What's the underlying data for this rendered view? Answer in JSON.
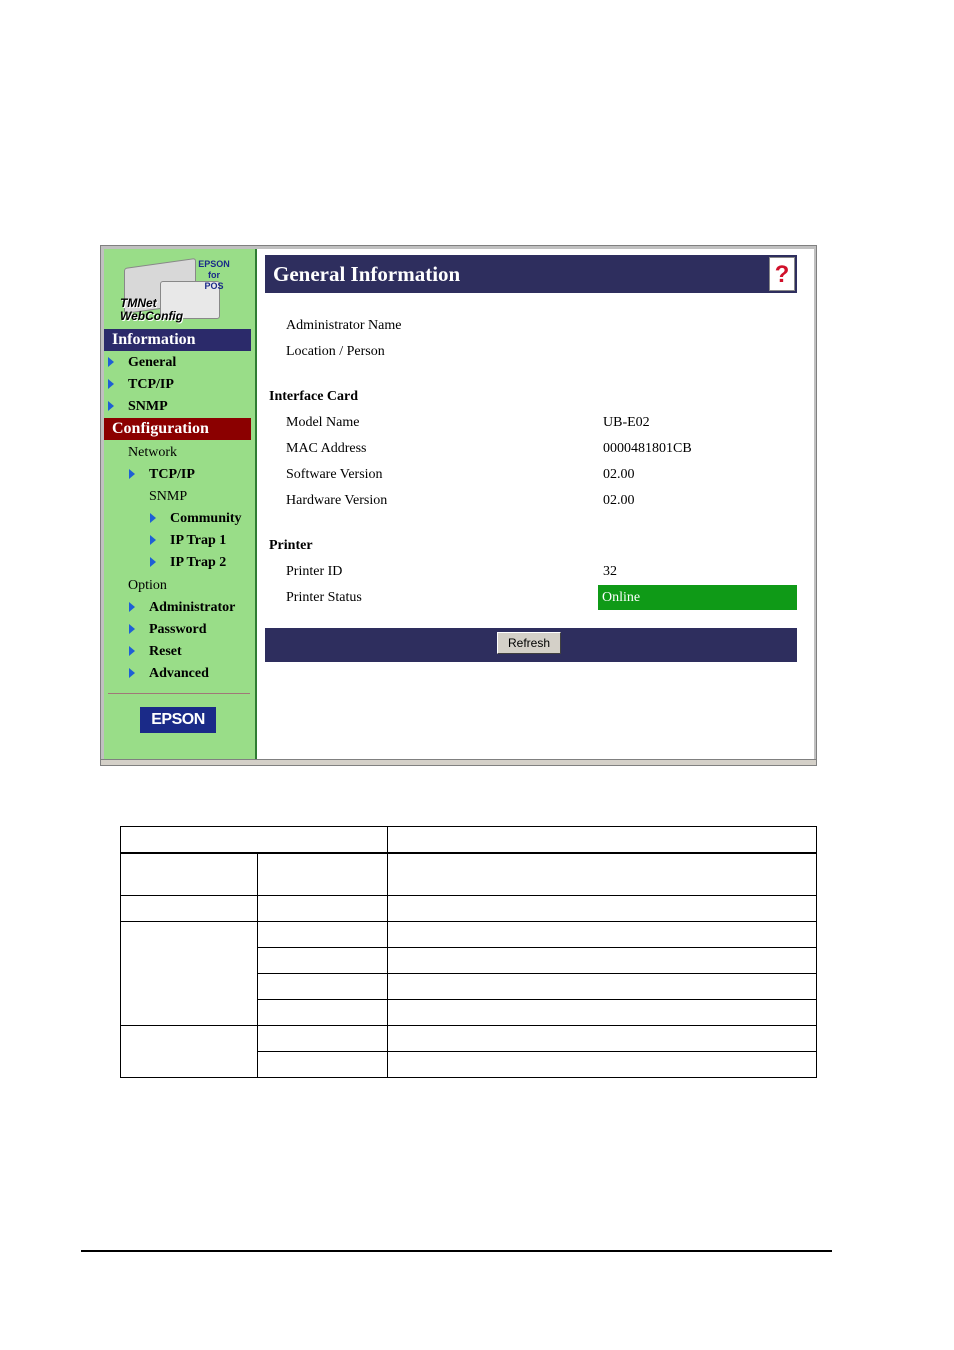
{
  "sidebar": {
    "logo": {
      "brand_tag": [
        "EPSON",
        "for",
        "POS"
      ],
      "product_name_line1": "TMNet",
      "product_name_line2": "WebConfig"
    },
    "information": {
      "header": "Information",
      "items": [
        {
          "label": "General"
        },
        {
          "label": "TCP/IP"
        },
        {
          "label": "SNMP"
        }
      ]
    },
    "configuration": {
      "header": "Configuration",
      "network_label": "Network",
      "tcpip": "TCP/IP",
      "snmp_label": "SNMP",
      "snmp_items": [
        {
          "label": "Community"
        },
        {
          "label": "IP Trap 1"
        },
        {
          "label": "IP Trap 2"
        }
      ],
      "option_label": "Option",
      "option_items": [
        {
          "label": "Administrator"
        },
        {
          "label": "Password"
        },
        {
          "label": "Reset"
        },
        {
          "label": "Advanced"
        }
      ]
    },
    "footer_logo": "EPSON"
  },
  "content": {
    "title": "General Information",
    "help_icon": "?",
    "admin": {
      "name_label": "Administrator Name",
      "location_label": "Location / Person"
    },
    "interface_card": {
      "heading": "Interface Card",
      "rows": [
        {
          "label": "Model Name",
          "value": "UB-E02"
        },
        {
          "label": "MAC Address",
          "value": "0000481801CB"
        },
        {
          "label": "Software Version",
          "value": "02.00"
        },
        {
          "label": "Hardware Version",
          "value": "02.00"
        }
      ]
    },
    "printer": {
      "heading": "Printer",
      "printer_id_label": "Printer ID",
      "printer_id_value": "32",
      "status_label": "Printer Status",
      "status_value": "Online"
    },
    "refresh_button": "Refresh"
  },
  "colors": {
    "title_bar": "#2e2e5e",
    "sidebar_bg": "#99dd88",
    "info_header": "#2b2a6a",
    "config_header": "#8b0000",
    "status_online": "#0f9a17",
    "nav_arrow": "#1e5fd6"
  }
}
